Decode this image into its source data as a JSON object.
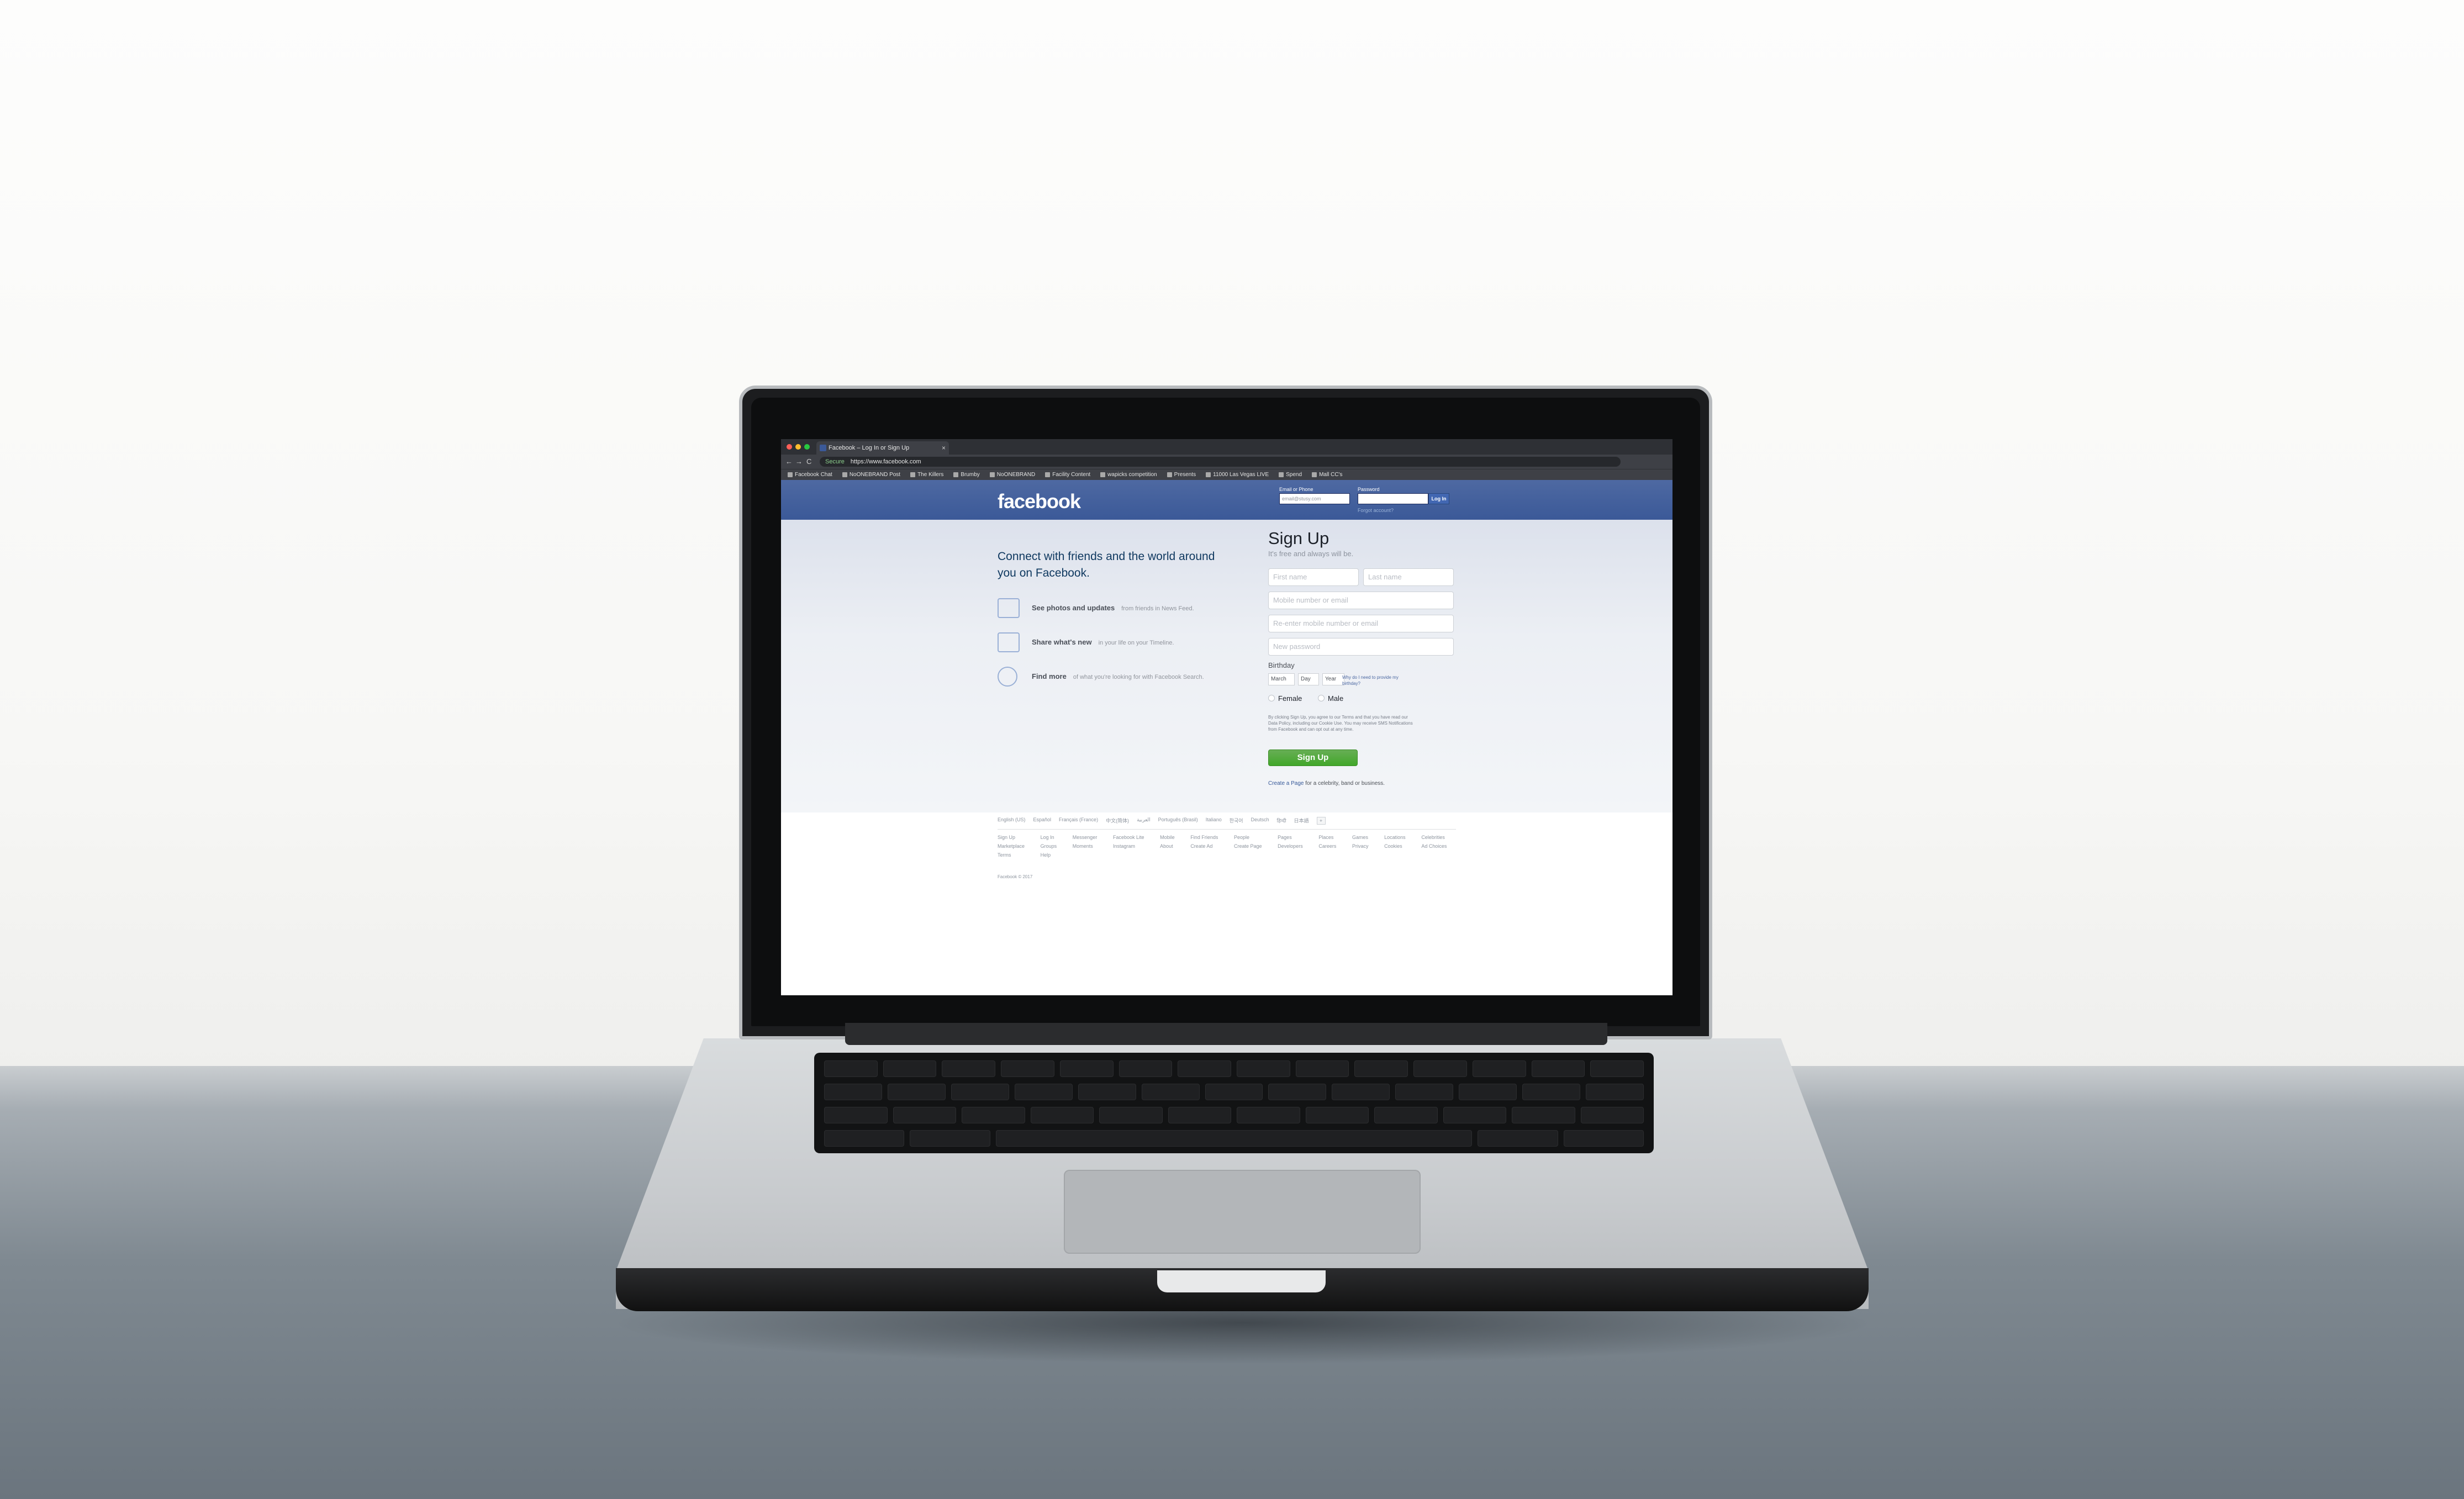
{
  "browser": {
    "tab_title": "Facebook – Log In or Sign Up",
    "tab_close": "×",
    "nav_back": "←",
    "nav_forward": "→",
    "nav_reload": "C",
    "secure_label": "Secure",
    "url": "https://www.facebook.com",
    "bookmarks": [
      "Facebook Chat",
      "NoONEBRAND Post",
      "The Killers",
      "Brumby",
      "NoONEBRAND",
      "Facility Content",
      "wapicks competition",
      "Presents",
      "11000 Las Vegas LIVE",
      "Spend",
      "Mall CC's"
    ]
  },
  "fb": {
    "logo": "facebook",
    "email_label": "Email or Phone",
    "email_value": "email@stusy.com",
    "password_label": "Password",
    "login_button": "Log In",
    "forgot_link": "Forgot account?",
    "tagline": "Connect with friends and the world around you on Facebook.",
    "features": [
      {
        "title": "See photos and updates",
        "desc": "from friends in News Feed."
      },
      {
        "title": "Share what's new",
        "desc": "in your life on your Timeline."
      },
      {
        "title": "Find more",
        "desc": "of what you're looking for with Facebook Search."
      }
    ],
    "signup_title": "Sign Up",
    "signup_subtitle": "It's free and always will be.",
    "first_name_placeholder": "First name",
    "last_name_placeholder": "Last name",
    "mobile_placeholder": "Mobile number or email",
    "reenter_placeholder": "Re-enter mobile number or email",
    "password_placeholder": "New password",
    "birthday_label": "Birthday",
    "month": "March",
    "day": "Day",
    "year": "Year",
    "why_birthday": "Why do I need to provide my birthday?",
    "female": "Female",
    "male": "Male",
    "terms": "By clicking Sign Up, you agree to our Terms and that you have read our Data Policy, including our Cookie Use. You may receive SMS Notifications from Facebook and can opt out at any time.",
    "signup_button": "Sign Up",
    "create_page_prefix": "Create a Page",
    "create_page_suffix": "for a celebrity, band or business.",
    "languages": [
      "English (US)",
      "Español",
      "Français (France)",
      "中文(简体)",
      "العربية",
      "Português (Brasil)",
      "Italiano",
      "한국어",
      "Deutsch",
      "हिन्दी",
      "日本語"
    ],
    "language_plus": "+",
    "footer_links": [
      "Sign Up",
      "Log In",
      "Messenger",
      "Facebook Lite",
      "Mobile",
      "Find Friends",
      "People",
      "Pages",
      "Places",
      "Games",
      "Locations",
      "Celebrities",
      "Marketplace",
      "Groups",
      "Moments",
      "Instagram",
      "About",
      "Create Ad",
      "Create Page",
      "Developers",
      "Careers",
      "Privacy",
      "Cookies",
      "Ad Choices",
      "Terms",
      "Help"
    ],
    "copyright": "Facebook © 2017"
  }
}
